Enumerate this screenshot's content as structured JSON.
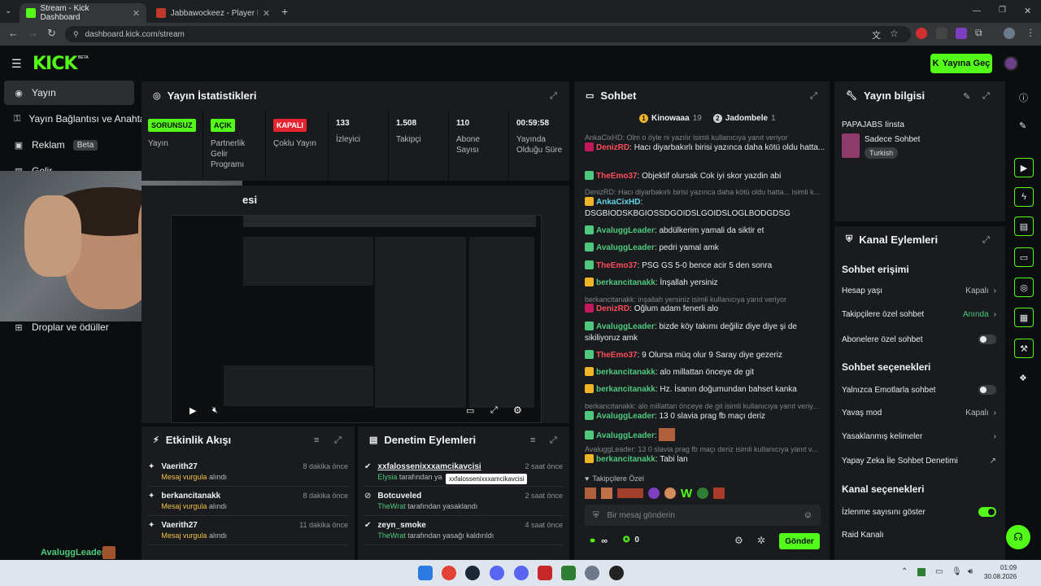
{
  "browser": {
    "tabs": [
      {
        "title": "Stream - Kick Dashboard",
        "active": true
      },
      {
        "title": "Jabbawockeez - Player Profile -",
        "active": false
      }
    ],
    "url": "dashboard.kick.com/stream"
  },
  "header": {
    "logo": "KICK",
    "logo_sup": "BETA",
    "go_live": "Yayına Geç"
  },
  "sidebar": {
    "items": [
      {
        "label": "Yayın"
      },
      {
        "label": "Yayın Bağlantısı ve Anahtar"
      },
      {
        "label": "Reklam",
        "badge": "Beta"
      },
      {
        "label": "Gelir"
      },
      {
        "label": "Droplar ve ödüller"
      }
    ],
    "bottom_user": "AvaluggLeader"
  },
  "stats": {
    "title": "Yayın İstatistikleri",
    "cells": [
      {
        "pill": "SORUNSUZ",
        "label": "Yayın"
      },
      {
        "pill": "AÇIK",
        "label": "Partnerlik Gelir Programı"
      },
      {
        "pill": "KAPALI",
        "label": "Çoklu Yayın"
      },
      {
        "value": "133",
        "label": "İzleyici"
      },
      {
        "value": "1.508",
        "label": "Takipçi"
      },
      {
        "value": "110",
        "label": "Abone Sayısı"
      },
      {
        "value": "00:59:58",
        "label": "Yayında Olduğu Süre"
      }
    ]
  },
  "preview": {
    "title_partial": "esi"
  },
  "chat": {
    "title": "Sohbet",
    "top_users": [
      {
        "rank": "1",
        "name": "Kinowaaa",
        "count": "19"
      },
      {
        "rank": "2",
        "name": "Jadombele",
        "count": "1"
      }
    ],
    "messages": [
      {
        "reply": "AnkaCixHD: Olm o öyle ni yazılır isimli kullanıcıya yanıt veriyor"
      },
      {
        "user": "DenizRD",
        "color": "r",
        "text": "Hacı diyarbakırlı birisi yazınca daha kötü oldu hatta..."
      },
      {
        "user": "TheEmo37",
        "color": "r",
        "text": "Objektif olursak Cok iyi skor yazdin abi"
      },
      {
        "reply": "DenizRD: Hacı diyarbakırlı birisi yazınca daha kötü oldu hatta... isimli k..."
      },
      {
        "user": "AnkaCixHD",
        "color": "c",
        "text": "DSGBIODSKBGIOSSDGOIDSLGOIDSLOGLBODGDSG"
      },
      {
        "user": "AvaluggLeader",
        "color": "g",
        "text": "abdülkerim yamali da siktir et"
      },
      {
        "user": "AvaluggLeader",
        "color": "g",
        "text": "pedri yamal amk"
      },
      {
        "user": "TheEmo37",
        "color": "r",
        "text": "PSG GS 5-0 bence acir 5 den sonra"
      },
      {
        "user": "berkancitanakk",
        "color": "g",
        "text": "İnşallah yersiniz"
      },
      {
        "reply": "berkancitanakk: inşallah yersiniz isimli kullanıcıya yanıt veriyor"
      },
      {
        "user": "DenizRD",
        "color": "r",
        "text": "Oğlum adam fenerli alo"
      },
      {
        "user": "AvaluggLeader",
        "color": "g",
        "text": "bizde köy takımı değiliz diye diye şi de sikiliyoruz amk"
      },
      {
        "user": "TheEmo37",
        "color": "r",
        "text": "9 Olursa müq olur 9 Saray diye gezeriz"
      },
      {
        "user": "berkancitanakk",
        "color": "g",
        "text": "alo millattan önceye de git"
      },
      {
        "user": "berkancitanakk",
        "color": "g",
        "text": "Hz. İsanın doğumundan bahset kanka"
      },
      {
        "reply": "berkancitanakk: alo millattan önceye de git isimli kullanıcıya yanıt veriy..."
      },
      {
        "user": "AvaluggLeader",
        "color": "g",
        "text": "13 0 slavia prag fb maçı deriz"
      },
      {
        "user": "AvaluggLeader",
        "color": "g",
        "text": ""
      },
      {
        "reply": "AvaluggLeader: 13 0 slavia prag fb maçı deriz isimli kullanıcıya yanıt v..."
      },
      {
        "user": "berkancitanakk",
        "color": "g",
        "text": "Tabi lan"
      }
    ],
    "followers_only": "Takipçilere Özel",
    "input_placeholder": "Bir mesaj gönderin",
    "infinity_count": "∞",
    "points": "0",
    "send": "Gönder"
  },
  "stream_info": {
    "title": "Yayın bilgisi",
    "stream_title": "PAPAJABS Iinsta",
    "category": "Sadece Sohbet",
    "tag": "Turkish"
  },
  "channel_actions": {
    "title": "Kanal Eylemleri",
    "sections": [
      {
        "heading": "Sohbet erişimi"
      },
      {
        "label": "Hesap yaşı",
        "value": "Kapalı"
      },
      {
        "label": "Takipçilere özel sohbet",
        "value": "Anında"
      },
      {
        "label": "Abonelere özel sohbet",
        "toggle": false
      },
      {
        "heading": "Sohbet seçenekleri"
      },
      {
        "label": "Yalnızca Emotlarla sohbet",
        "toggle": false
      },
      {
        "label": "Yavaş mod",
        "value": "Kapalı"
      },
      {
        "label": "Yasaklanmış kelimeler"
      },
      {
        "label": "Yapay Zeka İle Sohbet Denetimi"
      },
      {
        "heading": "Kanal seçenekleri"
      },
      {
        "label": "İzlenme sayısını göster",
        "toggle": true
      },
      {
        "label": "Raid Kanalı"
      }
    ]
  },
  "activity": {
    "title": "Etkinlik Akışı",
    "rows": [
      {
        "name": "Vaerith27",
        "sub_hl": "Mesaj vurgula",
        "sub": "alındı",
        "time": "8 dakika önce"
      },
      {
        "name": "berkancitanakk",
        "sub_hl": "Mesaj vurgula",
        "sub": "alındı",
        "time": "8 dakika önce"
      },
      {
        "name": "Vaerith27",
        "sub_hl": "Mesaj vurgula",
        "sub": "alındı",
        "time": "11 dakika önce"
      }
    ]
  },
  "moderation": {
    "title": "Denetim Eylemleri",
    "tooltip": "xxfalossenixxxamcikavcisi",
    "rows": [
      {
        "name": "xxfalossenixxxamcikavcisi",
        "by": "Elysia",
        "sub": "tarafından ya",
        "time": "2 saat önce"
      },
      {
        "name": "Botcuveled",
        "by": "TheWrat",
        "sub": "tarafından yasaklandı",
        "time": "2 saat önce"
      },
      {
        "name": "zeyn_smoke",
        "by": "TheWrat",
        "sub": "tarafından yasağı kaldırıldı",
        "time": "4 saat önce"
      }
    ]
  },
  "taskbar": {
    "time": "01:09",
    "date": "30.08.2026"
  },
  "colors": {
    "accent": "#53fc18",
    "panel": "#191b1f",
    "bg": "#0b0e0f"
  }
}
